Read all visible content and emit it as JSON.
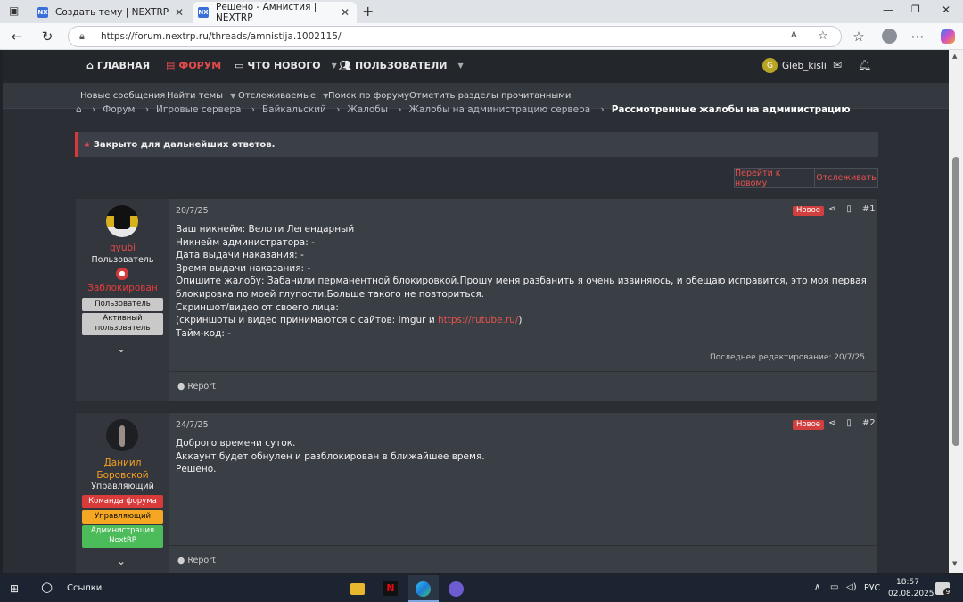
{
  "browser": {
    "tabs": [
      {
        "title": "Создать тему | NEXTRP",
        "fav": "NX"
      },
      {
        "title": "Решено - Амнистия | NEXTRP",
        "fav": "NX"
      }
    ],
    "url": "https://forum.nextrp.ru/threads/amnistija.1002115/"
  },
  "header": {
    "nav": [
      "ГЛАВНАЯ",
      "ФОРУМ",
      "ЧТО НОВОГО",
      "ПОЛЬЗОВАТЕЛИ"
    ],
    "user": "Gleb_kisli",
    "avatar_letter": "G"
  },
  "subnav": [
    "Новые сообщения",
    "Найти темы",
    "Отслеживаемые",
    "Поиск по форуму",
    "Отметить разделы прочитанными"
  ],
  "breadcrumb": [
    "Форум",
    "Игровые сервера",
    "Байкальский",
    "Жалобы",
    "Жалобы на администрацию сервера",
    "Рассмотренные жалобы на администрацию"
  ],
  "notice": "Закрыто для дальнейших ответов.",
  "buttons": {
    "goto_new": "Перейти к новому",
    "watch": "Отслеживать"
  },
  "posts": [
    {
      "user": "qyubi",
      "role": "Пользователь",
      "banned": "Заблокирован",
      "badges": [
        "Пользователь",
        "Активный пользователь"
      ],
      "date": "20/7/25",
      "new": "Новое",
      "num": "#1",
      "lines": [
        "Ваш никнейм: Велоти Легендарный",
        "Никнейм администратора: -",
        "Дата выдачи наказания: -",
        "Время выдачи наказания: -",
        "Опишите жалобу: Забанили перманентной блокировкой.Прошу меня разбанить я очень извиняюсь, и обещаю исправится, это моя первая блокировка по моей глупости.Больше такого не повториться.",
        "Скриншот/видео от своего лица:"
      ],
      "line_pre": "(скриншоты и видео принимаются с сайтов: Imgur и ",
      "link": "https://rutube.ru/",
      "line_post": ")",
      "line_last": "Тайм-код: -",
      "edited": "Последнее редактирование: 20/7/25",
      "report": "Report"
    },
    {
      "user_line1": "Даниил",
      "user_line2": "Боровской",
      "role": "Управляющий",
      "badges": [
        "Команда форума",
        "Управляющий",
        "Администрация NextRP"
      ],
      "date": "24/7/25",
      "new": "Новое",
      "num": "#2",
      "lines": [
        "Доброго времени суток.",
        "Аккаунт будет обнулен и разблокирован в ближайшее время.",
        "Решено."
      ],
      "report": "Report"
    }
  ],
  "taskbar": {
    "links": "Ссылки",
    "lang": "РУС",
    "time": "18:57",
    "date": "02.08.2025",
    "notif": "9"
  },
  "colors": {
    "accent": "#e54b4b",
    "bg": "#2b2f35"
  }
}
